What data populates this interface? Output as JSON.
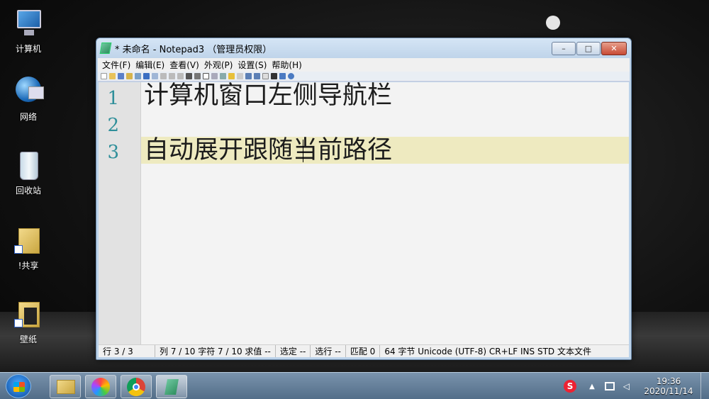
{
  "desktop": {
    "icons": [
      {
        "label": "计算机"
      },
      {
        "label": "网络"
      },
      {
        "label": "回收站"
      },
      {
        "label": "!共享"
      },
      {
        "label": "壁纸"
      }
    ]
  },
  "window": {
    "title": "* 未命名 - Notepad3 （管理员权限）",
    "menu": [
      "文件(F)",
      "编辑(E)",
      "查看(V)",
      "外观(P)",
      "设置(S)",
      "帮助(H)"
    ],
    "controls": {
      "minimize": "–",
      "maximize": "□",
      "close": "✕"
    }
  },
  "editor": {
    "line_numbers": [
      "1",
      "2",
      "3"
    ],
    "lines": [
      "计算机窗口左侧导航栏",
      "",
      "自动展开跟随当前路径"
    ]
  },
  "statusbar": {
    "row": "行 3 / 3",
    "col": "列  7 / 10  字符  7 / 10  求值  --",
    "sel": "选定  --",
    "sel_lines": "选行  --",
    "match": "匹配  0",
    "info": "64 字节  Unicode (UTF-8)  CR+LF  INS  STD  文本文件"
  },
  "taskbar": {
    "time": "19:36",
    "date": "2020/11/14",
    "ime": "S"
  },
  "colors": {
    "current_line": "#eeeac0",
    "line_number": "#2f8f9a",
    "close_button": "#c74a35"
  }
}
